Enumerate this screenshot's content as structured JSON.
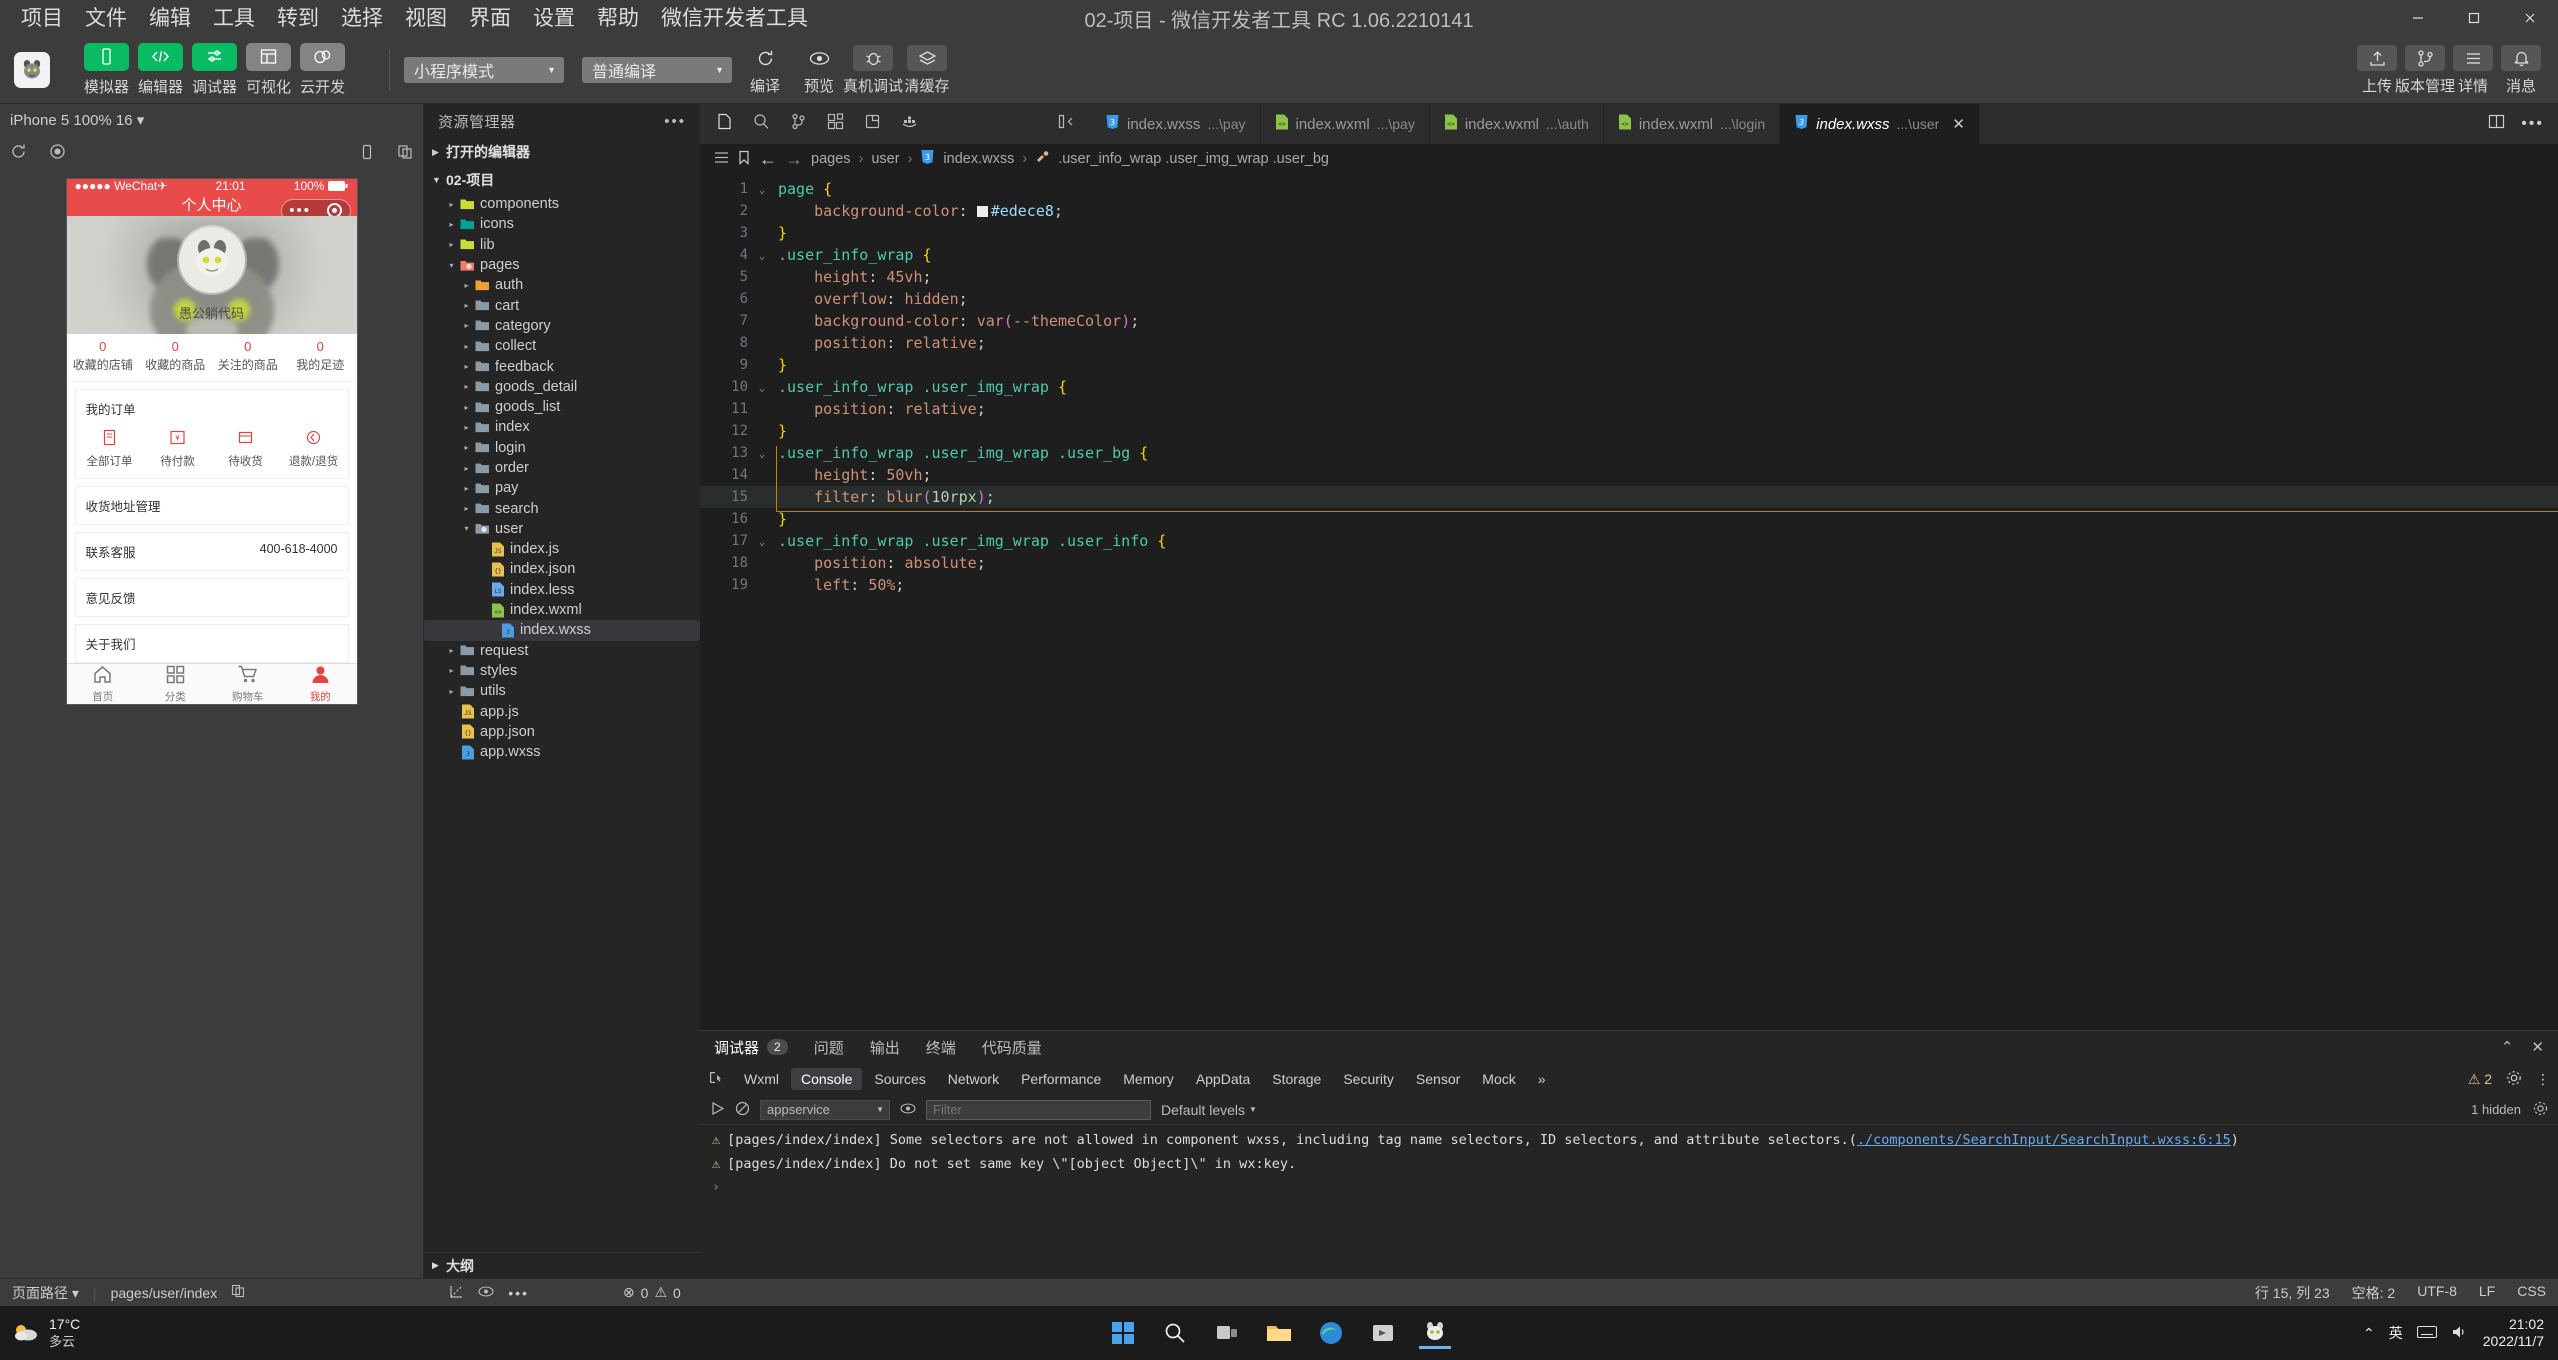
{
  "titlebar": {
    "menus": [
      "项目",
      "文件",
      "编辑",
      "工具",
      "转到",
      "选择",
      "视图",
      "界面",
      "设置",
      "帮助",
      "微信开发者工具"
    ],
    "window_title": "02-项目 - 微信开发者工具 RC 1.06.2210141",
    "minimize": "—",
    "maximize": "▢",
    "close": "✕"
  },
  "toolbar": {
    "buttons": [
      {
        "label": "模拟器",
        "icon": "phone-icon",
        "style": "green"
      },
      {
        "label": "编辑器",
        "icon": "code-icon",
        "style": "green"
      },
      {
        "label": "调试器",
        "icon": "sliders-icon",
        "style": "green"
      },
      {
        "label": "可视化",
        "icon": "layout-icon",
        "style": "grey"
      },
      {
        "label": "云开发",
        "icon": "cloud-icon",
        "style": "grey"
      }
    ],
    "mode_select": "小程序模式",
    "compile_select": "普通编译",
    "actions": [
      {
        "label": "编译",
        "icon": "refresh-icon"
      },
      {
        "label": "预览",
        "icon": "eye-icon"
      },
      {
        "label": "真机调试",
        "icon": "bug-icon"
      },
      {
        "label": "清缓存",
        "icon": "layers-icon"
      }
    ],
    "right_actions": [
      {
        "label": "上传",
        "icon": "upload-icon"
      },
      {
        "label": "版本管理",
        "icon": "branch-icon"
      },
      {
        "label": "详情",
        "icon": "list-icon"
      },
      {
        "label": "消息",
        "icon": "bell-icon"
      }
    ]
  },
  "simulator": {
    "device": "iPhone 5 100% 16 ▾",
    "icons": [
      "refresh-icon",
      "record-icon",
      "rotate-icon",
      "copy-icon"
    ],
    "phone": {
      "carrier": "●●●●● WeChat",
      "wifi": "✈",
      "time": "21:01",
      "battery_pct": "100%",
      "nav_title": "个人中心",
      "user_name": "愚公躺代码",
      "stats": [
        {
          "num": "0",
          "text": "收藏的店铺"
        },
        {
          "num": "0",
          "text": "收藏的商品"
        },
        {
          "num": "0",
          "text": "关注的商品"
        },
        {
          "num": "0",
          "text": "我的足迹"
        }
      ],
      "orders_title": "我的订单",
      "orders": [
        {
          "label": "全部订单",
          "icon": "doc-icon"
        },
        {
          "label": "待付款",
          "icon": "yuan-icon"
        },
        {
          "label": "待收货",
          "icon": "box-icon"
        },
        {
          "label": "退款/退货",
          "icon": "return-icon"
        }
      ],
      "rows": [
        {
          "label": "收货地址管理",
          "value": ""
        },
        {
          "label": "联系客服",
          "value": "400-618-4000"
        },
        {
          "label": "意见反馈",
          "value": ""
        },
        {
          "label": "关于我们",
          "value": ""
        }
      ],
      "tabbar": [
        {
          "label": "首页",
          "icon": "home-icon",
          "active": false
        },
        {
          "label": "分类",
          "icon": "grid-icon",
          "active": false
        },
        {
          "label": "购物车",
          "icon": "cart-icon",
          "active": false
        },
        {
          "label": "我的",
          "icon": "user-icon",
          "active": true
        }
      ]
    }
  },
  "explorer": {
    "title": "资源管理器",
    "open_editors": "打开的编辑器",
    "project": "02-项目",
    "outline": "大纲",
    "tree": [
      {
        "label": "components",
        "depth": 1,
        "type": "folder",
        "arrow": "▸",
        "color": "#cddc39"
      },
      {
        "label": "icons",
        "depth": 1,
        "type": "folder",
        "arrow": "▸",
        "color": "#00a396"
      },
      {
        "label": "lib",
        "depth": 1,
        "type": "folder",
        "arrow": "▸",
        "color": "#cddc39"
      },
      {
        "label": "pages",
        "depth": 1,
        "type": "folder-open",
        "arrow": "▾",
        "color": "#f4786b"
      },
      {
        "label": "auth",
        "depth": 2,
        "type": "folder",
        "arrow": "▸",
        "color": "#f0a030"
      },
      {
        "label": "cart",
        "depth": 2,
        "type": "folder",
        "arrow": "▸",
        "color": "#8a9ba8"
      },
      {
        "label": "category",
        "depth": 2,
        "type": "folder",
        "arrow": "▸",
        "color": "#8a9ba8"
      },
      {
        "label": "collect",
        "depth": 2,
        "type": "folder",
        "arrow": "▸",
        "color": "#8a9ba8"
      },
      {
        "label": "feedback",
        "depth": 2,
        "type": "folder",
        "arrow": "▸",
        "color": "#8a9ba8"
      },
      {
        "label": "goods_detail",
        "depth": 2,
        "type": "folder",
        "arrow": "▸",
        "color": "#8a9ba8"
      },
      {
        "label": "goods_list",
        "depth": 2,
        "type": "folder",
        "arrow": "▸",
        "color": "#8a9ba8"
      },
      {
        "label": "index",
        "depth": 2,
        "type": "folder",
        "arrow": "▸",
        "color": "#8a9ba8"
      },
      {
        "label": "login",
        "depth": 2,
        "type": "folder",
        "arrow": "▸",
        "color": "#8a9ba8"
      },
      {
        "label": "order",
        "depth": 2,
        "type": "folder",
        "arrow": "▸",
        "color": "#8a9ba8"
      },
      {
        "label": "pay",
        "depth": 2,
        "type": "folder",
        "arrow": "▸",
        "color": "#8a9ba8"
      },
      {
        "label": "search",
        "depth": 2,
        "type": "folder",
        "arrow": "▸",
        "color": "#8a9ba8"
      },
      {
        "label": "user",
        "depth": 2,
        "type": "folder-open",
        "arrow": "▾",
        "color": "#8a9ba8"
      },
      {
        "label": "index.js",
        "depth": 3,
        "type": "js",
        "arrow": "",
        "color": "#e8c14d"
      },
      {
        "label": "index.json",
        "depth": 3,
        "type": "json",
        "arrow": "",
        "color": "#e8c14d"
      },
      {
        "label": "index.less",
        "depth": 3,
        "type": "less",
        "arrow": "",
        "color": "#6aa9e9"
      },
      {
        "label": "index.wxml",
        "depth": 3,
        "type": "wxml",
        "arrow": "",
        "color": "#8bc34a"
      },
      {
        "label": "index.wxss",
        "depth": 3,
        "type": "wxss",
        "arrow": "",
        "color": "#4a9de0",
        "selected": true
      },
      {
        "label": "request",
        "depth": 1,
        "type": "folder",
        "arrow": "▸",
        "color": "#8a9ba8"
      },
      {
        "label": "styles",
        "depth": 1,
        "type": "folder",
        "arrow": "▸",
        "color": "#8a9ba8"
      },
      {
        "label": "utils",
        "depth": 1,
        "type": "folder",
        "arrow": "▸",
        "color": "#8a9ba8"
      },
      {
        "label": "app.js",
        "depth": 1,
        "type": "js",
        "arrow": "",
        "color": "#e8c14d"
      },
      {
        "label": "app.json",
        "depth": 1,
        "type": "json",
        "arrow": "",
        "color": "#e8c14d"
      },
      {
        "label": "app.wxss",
        "depth": 1,
        "type": "wxss",
        "arrow": "",
        "color": "#4a9de0"
      }
    ]
  },
  "editor": {
    "side_icons": [
      "file-icon",
      "search-icon",
      "source-control-icon",
      "extensions-icon",
      "debug-icon",
      "docker-icon"
    ],
    "collapse_icon": "collapse-panel-icon",
    "tabs": [
      {
        "name": "index.wxss",
        "path": "...\\pay",
        "kind": "wxss",
        "active": false
      },
      {
        "name": "index.wxml",
        "path": "...\\pay",
        "kind": "wxml",
        "active": false
      },
      {
        "name": "index.wxml",
        "path": "...\\auth",
        "kind": "wxml",
        "active": false
      },
      {
        "name": "index.wxml",
        "path": "...\\login",
        "kind": "wxml",
        "active": false
      },
      {
        "name": "index.wxss",
        "path": "...\\user",
        "kind": "wxss",
        "active": true
      }
    ],
    "tab_right_icons": [
      "split-editor-icon",
      "more-actions-icon"
    ],
    "breadcrumb": [
      "pages",
      "user",
      "index.wxss",
      ".user_info_wrap .user_img_wrap .user_bg"
    ],
    "breadcrumb_icons": [
      "outline-icon",
      "bookmark-icon",
      "back-arrow-icon",
      "forward-arrow-icon"
    ],
    "lines": [
      {
        "n": "1",
        "fold": "⌄",
        "html": "<span class='c-sel'>page</span> <span class='c-brace'>{</span>"
      },
      {
        "n": "2",
        "fold": "",
        "html": "    <span class='c-prop'>background-color</span>: <span class='swatch'></span><span class='c-var'>#edece8</span>;"
      },
      {
        "n": "3",
        "fold": "",
        "html": "<span class='c-brace'>}</span>"
      },
      {
        "n": "4",
        "fold": "⌄",
        "html": "<span class='c-sel'>.user_info_wrap</span> <span class='c-brace'>{</span>"
      },
      {
        "n": "5",
        "fold": "",
        "html": "    <span class='c-prop'>height</span>: <span class='c-val'>45vh</span>;"
      },
      {
        "n": "6",
        "fold": "",
        "html": "    <span class='c-prop'>overflow</span>: <span class='c-val'>hidden</span>;"
      },
      {
        "n": "7",
        "fold": "",
        "html": "    <span class='c-prop'>background-color</span>: <span class='c-val'>var</span><span class='c-paren'>(</span><span class='c-val'>--themeColor</span><span class='c-paren'>)</span>;"
      },
      {
        "n": "8",
        "fold": "",
        "html": "    <span class='c-prop'>position</span>: <span class='c-val'>relative</span>;"
      },
      {
        "n": "9",
        "fold": "",
        "html": "<span class='c-brace'>}</span>"
      },
      {
        "n": "10",
        "fold": "⌄",
        "html": "<span class='c-sel'>.user_info_wrap .user_img_wrap</span> <span class='c-brace'>{</span>"
      },
      {
        "n": "11",
        "fold": "",
        "html": "    <span class='c-prop'>position</span>: <span class='c-val'>relative</span>;"
      },
      {
        "n": "12",
        "fold": "",
        "html": "<span class='c-brace'>}</span>"
      },
      {
        "n": "13",
        "fold": "⌄",
        "html": "<span class='c-sel'>.user_info_wrap .user_img_wrap .user_bg</span> <span class='c-brace'>{</span>"
      },
      {
        "n": "14",
        "fold": "",
        "html": "    <span class='c-prop'>height</span>: <span class='c-val'>50vh</span>;"
      },
      {
        "n": "15",
        "fold": "",
        "html": "    <span class='c-prop'>filter</span>: <span class='c-val'>blur</span><span class='c-paren'>(</span><span class='c-num'>10rpx</span><span class='c-paren'>)</span>;",
        "highlight": true
      },
      {
        "n": "16",
        "fold": "",
        "html": "<span class='c-brace'>}</span>"
      },
      {
        "n": "17",
        "fold": "⌄",
        "html": "<span class='c-sel'>.user_info_wrap .user_img_wrap .user_info</span> <span class='c-brace'>{</span>"
      },
      {
        "n": "18",
        "fold": "",
        "html": "    <span class='c-prop'>position</span>: <span class='c-val'>absolute</span>;"
      },
      {
        "n": "19",
        "fold": "",
        "html": "    <span class='c-prop'>left</span>: <span class='c-val'>50%</span>;"
      }
    ]
  },
  "console": {
    "top_tabs": [
      "调试器",
      "问题",
      "输出",
      "终端",
      "代码质量"
    ],
    "debugger_count": "2",
    "top_right_icons": [
      "chevron-up-icon",
      "close-icon"
    ],
    "dev_tabs": [
      "Wxml",
      "Console",
      "Sources",
      "Network",
      "Performance",
      "Memory",
      "AppData",
      "Storage",
      "Security",
      "Sensor",
      "Mock"
    ],
    "active_dev_tab": "Console",
    "overflow_icon": "»",
    "warn_badge": "⚠ 2",
    "right_icons": [
      "settings-gear-icon",
      "more-vertical-icon"
    ],
    "filter": {
      "record_icon": "record-icon",
      "clear_icon": "clear-icon",
      "context": "appservice",
      "eye_icon": "eye-icon",
      "placeholder": "Filter",
      "levels": "Default levels",
      "hidden_text": "1 hidden",
      "settings_icon": "settings-icon"
    },
    "logs": [
      {
        "icon": "⚠",
        "text": "[pages/index/index] Some selectors are not allowed in component wxss, including tag name selectors, ID selectors, and attribute selectors.(",
        "link": "./components/SearchInput/SearchInput.wxss:6:15",
        "tail": ")"
      },
      {
        "icon": "⚠",
        "text": "[pages/index/index] Do not set same key \\\"[object Object]\\\" in wx:key.",
        "link": "",
        "tail": ""
      }
    ],
    "prompt": "›"
  },
  "status": {
    "page_path_label": "页面路径 ▾",
    "page_path": "pages/user/index",
    "copy_icon": "copy-icon",
    "left_icons": [
      "expand-icon",
      "eye-icon",
      "more-icon"
    ],
    "errors": "0",
    "warnings": "0",
    "cursor": "行 15, 列 23",
    "spaces": "空格: 2",
    "encoding": "UTF-8",
    "eol": "LF",
    "language": "CSS"
  },
  "taskbar": {
    "weather_temp": "17°C",
    "weather_desc": "多云",
    "icons": [
      "windows-icon",
      "search-icon",
      "taskview-icon",
      "explorer-icon",
      "edge-icon",
      "store-icon",
      "wechat-devtools-icon"
    ],
    "tray": [
      "chevron-up-icon",
      "ime-icon",
      "keyboard-icon",
      "volume-icon"
    ],
    "ime": "英",
    "time": "21:02",
    "date": "2022/11/7"
  }
}
